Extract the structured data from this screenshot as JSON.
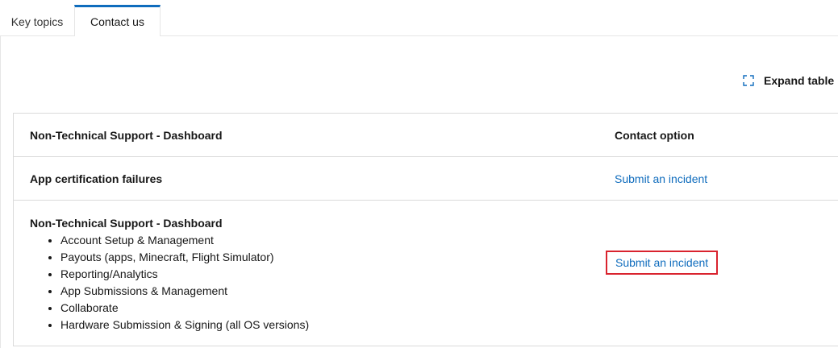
{
  "tabs": [
    {
      "label": "Key topics",
      "active": false
    },
    {
      "label": "Contact us",
      "active": true
    }
  ],
  "toolbar": {
    "expand_label": "Expand table",
    "expand_icon": "expand-icon"
  },
  "table": {
    "headers": [
      "Non-Technical Support - Dashboard",
      "Contact option"
    ],
    "rows": [
      {
        "title": "App certification failures",
        "action": "Submit an incident"
      },
      {
        "title": "Non-Technical Support - Dashboard",
        "items": [
          "Account Setup & Management",
          "Payouts (apps, Minecraft, Flight Simulator)",
          "Reporting/Analytics",
          "App Submissions & Management",
          "Collaborate",
          "Hardware Submission & Signing (all OS versions)"
        ],
        "action": "Submit an incident",
        "highlighted": true
      }
    ]
  },
  "colors": {
    "accent": "#0f6cbd",
    "highlight": "#d9232e"
  }
}
